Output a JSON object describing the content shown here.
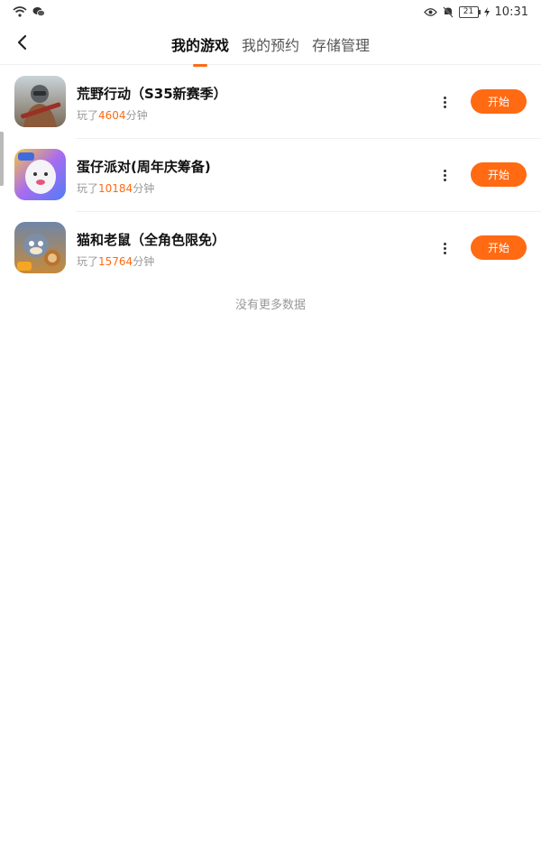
{
  "status_bar": {
    "battery": "21",
    "time": "10:31",
    "icons": [
      "wifi-icon",
      "wechat-icon",
      "eye-icon",
      "mute-bell-icon",
      "battery-icon",
      "charging-icon"
    ]
  },
  "header": {
    "back_icon": "chevron-left-icon",
    "tabs": [
      {
        "label": "我的游戏",
        "active": true
      },
      {
        "label": "我的预约",
        "active": false
      },
      {
        "label": "存储管理",
        "active": false
      }
    ]
  },
  "games": [
    {
      "title": "荒野行动（S35新赛季）",
      "played_prefix": "玩了",
      "minutes": "4604",
      "played_suffix": "分钟",
      "button": "开始"
    },
    {
      "title": "蛋仔派对(周年庆筹备)",
      "played_prefix": "玩了",
      "minutes": "10184",
      "played_suffix": "分钟",
      "button": "开始"
    },
    {
      "title": "猫和老鼠（全角色限免）",
      "played_prefix": "玩了",
      "minutes": "15764",
      "played_suffix": "分钟",
      "button": "开始"
    }
  ],
  "footer_text": "没有更多数据",
  "colors": {
    "accent": "#ff6a13",
    "muted": "#999999"
  }
}
